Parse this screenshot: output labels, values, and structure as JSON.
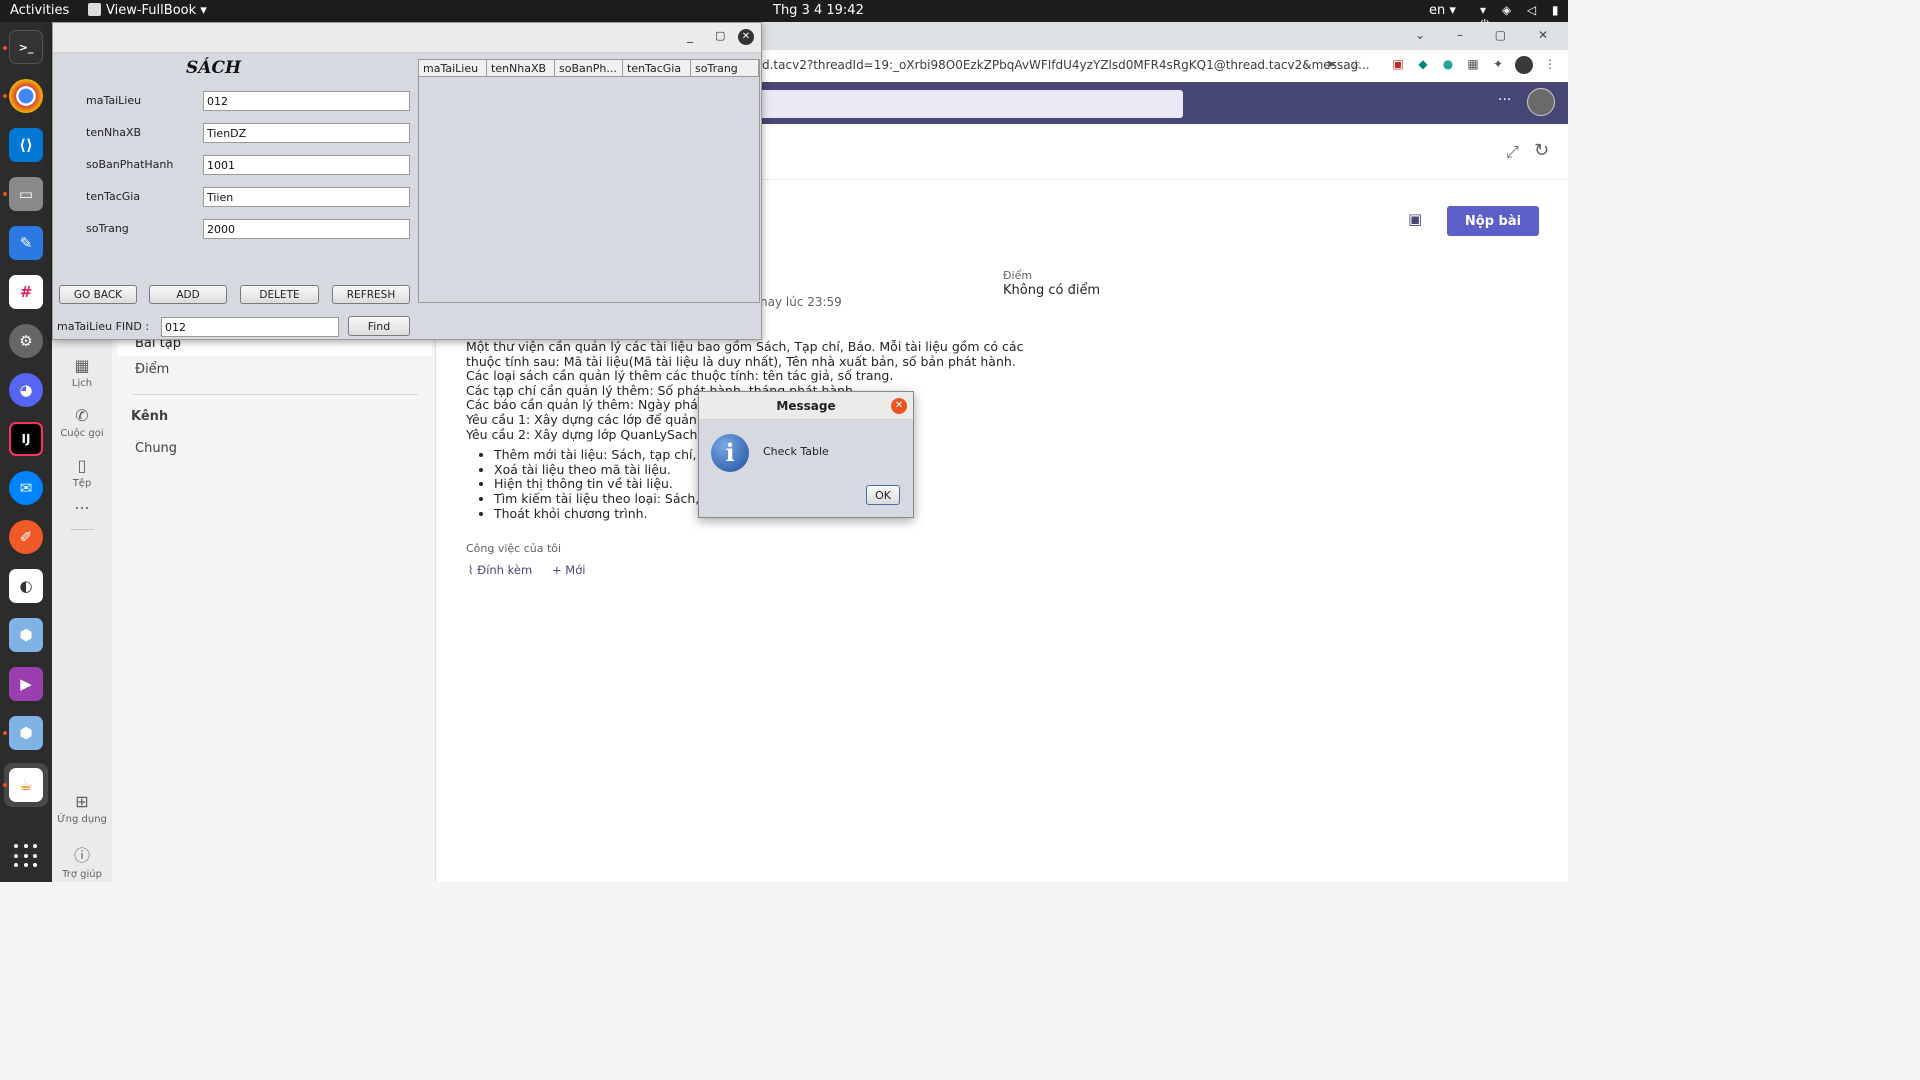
{
  "topbar": {
    "activities": "Activities",
    "app_name": "View-FullBook",
    "clock": "Thg 3 4  19:42",
    "lang": "en",
    "system_icons": "▾ ◈ ◁ ▮ ⏻"
  },
  "dock": {
    "items": [
      "terminal",
      "chrome",
      "vscode",
      "files",
      "text-editor",
      "slack",
      "settings",
      "discord",
      "intellij",
      "messenger",
      "pen-tool",
      "app",
      "virtualbox",
      "media",
      "virtualbox-2",
      "java"
    ]
  },
  "browser": {
    "url": "d.tacv2?threadId=19:_oXrbi98O0EzkZPbqAvWFIfdU4yzYZlsd0MFR4sRgKQ1@thread.tacv2&messag...",
    "window_controls": "⌄ – ▢ ✕"
  },
  "teams": {
    "rail": [
      {
        "label": "Lịch",
        "icon": "calendar-icon"
      },
      {
        "label": "Cuộc gọi",
        "icon": "phone-icon"
      },
      {
        "label": "Tệp",
        "icon": "file-icon"
      },
      {
        "label": "...",
        "icon": "more-icon"
      },
      {
        "label": "Ứng dụng",
        "icon": "apps-icon"
      },
      {
        "label": "Trợ giúp",
        "icon": "help-icon"
      }
    ],
    "nav": {
      "bai_tap": "Bài tập",
      "diem": "Điểm",
      "kenh": "Kênh",
      "chung": "Chung"
    },
    "header_more": "···",
    "submit_label": "Nộp bài",
    "diem_label": "Điểm",
    "diem_value": "Không có điểm",
    "due_text": "nay lúc 23:59",
    "description_lines": [
      "Một thư viện cần quản lý các tài liệu bao gồm Sách, Tạp chí, Báo. Mỗi tài liệu gồm có các",
      "thuộc tính sau: Mã tài liệu(Mã tài liệu là duy nhất), Tên nhà xuất bản, số bản phát hành.",
      "Các loại sách cần quản lý thêm các thuộc tính: tên tác giả, số trang.",
      "Các tạp chí cần quản lý thêm: Số phát hành, tháng phát hành.",
      "Các báo cần quản lý thêm: Ngày phát hành.",
      "Yêu cầu 1: Xây dựng các lớp để quản lý tài",
      "Yêu cầu 2: Xây dựng lớp QuanLySach có cá"
    ],
    "bullets": [
      "Thêm mới tài liệu: Sách, tạp chí, báo.",
      "Xoá tài liệu theo mã tài liệu.",
      "Hiện thị thông tin về tài liệu.",
      "Tìm kiếm tài liệu theo loại: Sách, tạp c",
      "Thoát khỏi chương trình."
    ],
    "my_work": "Công việc của tôi",
    "attach": "Đính kèm",
    "new": "Mới"
  },
  "java_app": {
    "title": "SÁCH",
    "fields": [
      {
        "label": "maTaiLieu",
        "value": "012"
      },
      {
        "label": "tenNhaXB",
        "value": "TienDZ"
      },
      {
        "label": "soBanPhatHanh",
        "value": "1001"
      },
      {
        "label": "tenTacGia",
        "value": "Tiien"
      },
      {
        "label": "soTrang",
        "value": "2000"
      }
    ],
    "table_columns": [
      "maTaiLieu",
      "tenNhaXB",
      "soBanPh...",
      "tenTacGia",
      "soTrang"
    ],
    "buttons": {
      "go_back": "GO BACK",
      "add": "ADD",
      "delete": "DELETE",
      "refresh": "REFRESH",
      "find": "Find"
    },
    "find_label": "maTaiLieu FIND :",
    "find_value": "012",
    "window_controls": {
      "min": "_",
      "max": "▢",
      "close": "✕"
    }
  },
  "dialog": {
    "title": "Message",
    "message": "Check Table",
    "ok": "OK",
    "info_glyph": "i"
  },
  "colors": {
    "teams_purple": "#464775",
    "teams_button": "#5b5fc7",
    "ubuntu_orange": "#e95420",
    "java_bg": "#d6d9df"
  }
}
